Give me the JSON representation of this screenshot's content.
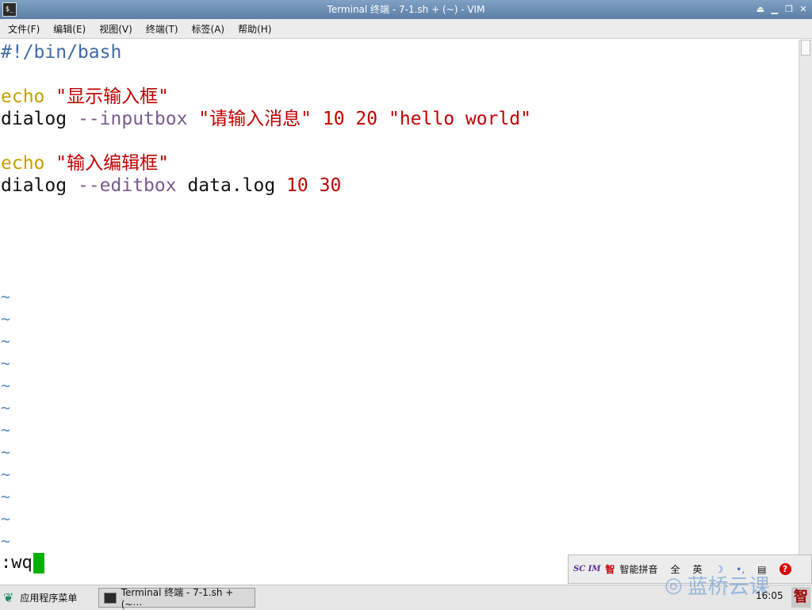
{
  "window": {
    "title": "Terminal 终端 - 7-1.sh + (~) - VIM",
    "icon": "terminal-icon",
    "controls": [
      "⏏",
      "▁",
      "❐",
      "✕"
    ]
  },
  "menu": [
    "文件(F)",
    "编辑(E)",
    "视图(V)",
    "终端(T)",
    "标签(A)",
    "帮助(H)"
  ],
  "editor": {
    "lines": [
      {
        "segments": [
          {
            "text": "#!/bin/bash",
            "cls": "c-shebang"
          }
        ]
      },
      {
        "segments": []
      },
      {
        "segments": [
          {
            "text": "echo",
            "cls": "c-kw"
          },
          {
            "text": " ",
            "cls": "c-plain"
          },
          {
            "text": "\"显示输入框\"",
            "cls": "c-str"
          }
        ]
      },
      {
        "segments": [
          {
            "text": "dialog",
            "cls": "c-plain"
          },
          {
            "text": " ",
            "cls": "c-plain"
          },
          {
            "text": "--inputbox",
            "cls": "c-opt"
          },
          {
            "text": " ",
            "cls": "c-plain"
          },
          {
            "text": "\"请输入消息\"",
            "cls": "c-str"
          },
          {
            "text": " ",
            "cls": "c-plain"
          },
          {
            "text": "10",
            "cls": "c-num"
          },
          {
            "text": " ",
            "cls": "c-plain"
          },
          {
            "text": "20",
            "cls": "c-num"
          },
          {
            "text": " ",
            "cls": "c-plain"
          },
          {
            "text": "\"hello world\"",
            "cls": "c-str"
          }
        ]
      },
      {
        "segments": []
      },
      {
        "segments": [
          {
            "text": "echo",
            "cls": "c-kw"
          },
          {
            "text": " ",
            "cls": "c-plain"
          },
          {
            "text": "\"输入编辑框\"",
            "cls": "c-str"
          }
        ]
      },
      {
        "segments": [
          {
            "text": "dialog",
            "cls": "c-plain"
          },
          {
            "text": " ",
            "cls": "c-plain"
          },
          {
            "text": "--editbox",
            "cls": "c-opt"
          },
          {
            "text": " ",
            "cls": "c-plain"
          },
          {
            "text": "data.log",
            "cls": "c-plain"
          },
          {
            "text": " ",
            "cls": "c-plain"
          },
          {
            "text": "10",
            "cls": "c-num"
          },
          {
            "text": " ",
            "cls": "c-plain"
          },
          {
            "text": "30",
            "cls": "c-num"
          }
        ]
      }
    ],
    "tilde": "~",
    "command": ":wq"
  },
  "ime": {
    "brand": "SC IM",
    "zhi": "智",
    "mode": "智能拼音",
    "full": "全",
    "english": "英",
    "moon": "☽",
    "punct": "•,",
    "keyboard": "▤",
    "help": "?"
  },
  "taskbar": {
    "app_menu": "应用程序菜单",
    "task": "Terminal 终端 - 7-1.sh + (~⋯",
    "watermark": "蓝桥云课",
    "clock": "16:05",
    "tray_ime": "智"
  }
}
